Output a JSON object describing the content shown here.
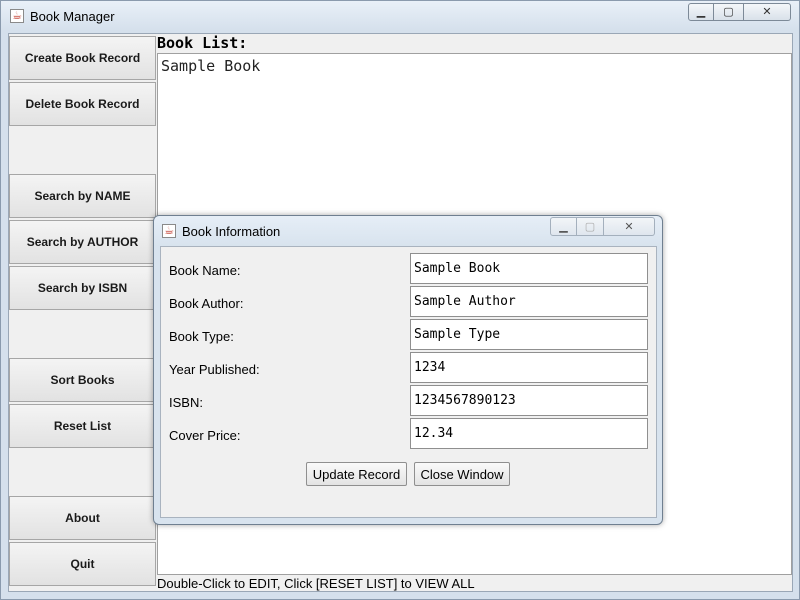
{
  "window": {
    "title": "Book Manager",
    "controls": {
      "minimize": "▁",
      "maximize": "▢",
      "close": "✕"
    }
  },
  "sidebar": {
    "buttons": [
      {
        "label": "Create Book Record"
      },
      {
        "label": "Delete Book Record"
      },
      {
        "label": "Search by NAME"
      },
      {
        "label": "Search by AUTHOR"
      },
      {
        "label": "Search by ISBN"
      },
      {
        "label": "Sort Books"
      },
      {
        "label": "Reset List"
      },
      {
        "label": "About"
      },
      {
        "label": "Quit"
      }
    ]
  },
  "list": {
    "heading": "Book List:",
    "items": [
      "Sample Book"
    ]
  },
  "status_text": "Double-Click to EDIT, Click [RESET LIST] to VIEW ALL",
  "dialog": {
    "title": "Book Information",
    "controls": {
      "minimize": "▁",
      "maximize": "▢",
      "close": "✕"
    },
    "fields": [
      {
        "label": "Book Name:",
        "value": "Sample Book"
      },
      {
        "label": "Book Author:",
        "value": "Sample Author"
      },
      {
        "label": "Book Type:",
        "value": "Sample Type"
      },
      {
        "label": "Year Published:",
        "value": "1234"
      },
      {
        "label": "ISBN:",
        "value": "1234567890123"
      },
      {
        "label": "Cover Price:",
        "value": "12.34"
      }
    ],
    "update_label": "Update Record",
    "close_label": "Close Window"
  },
  "icons": {
    "app": "java-cup-icon"
  }
}
